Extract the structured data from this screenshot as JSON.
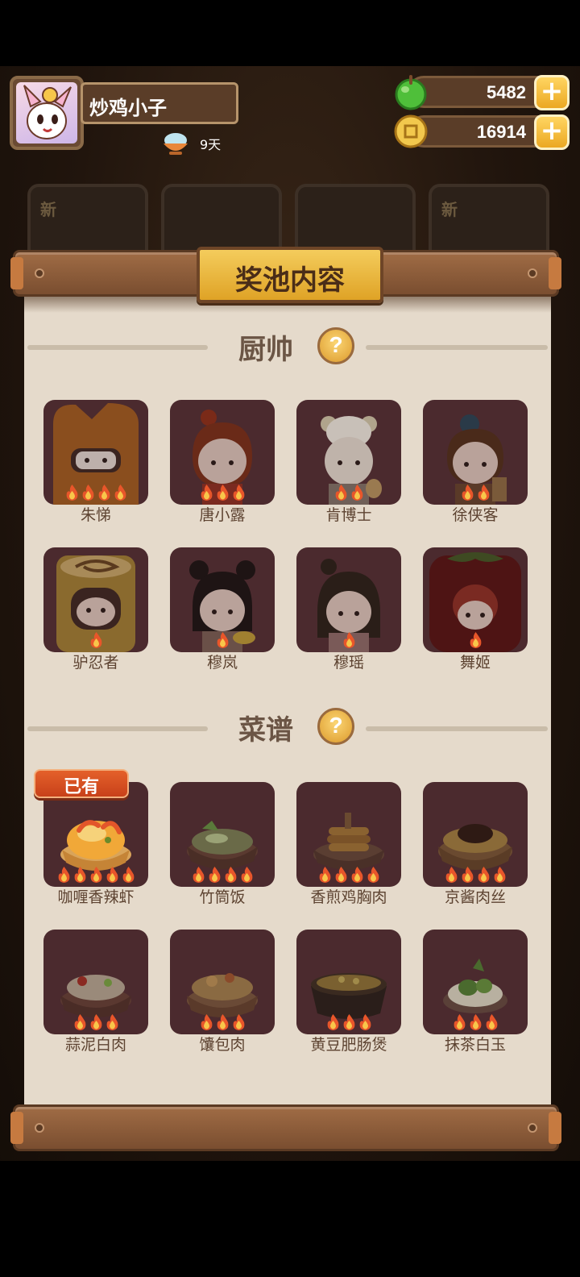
{
  "player": {
    "name": "炒鸡小子",
    "days": "9天"
  },
  "resources": {
    "green_value": "5482",
    "coin_value": "16914",
    "plus_label": "+"
  },
  "background": {
    "new_label": "新"
  },
  "popup": {
    "title": "奖池内容",
    "chef_section": {
      "title": "厨帅",
      "help_label": "?",
      "items": [
        {
          "label": "朱悌",
          "stars": 4
        },
        {
          "label": "唐小露",
          "stars": 3
        },
        {
          "label": "肯博士",
          "stars": 2
        },
        {
          "label": "徐侠客",
          "stars": 2
        },
        {
          "label": "驴忍者",
          "stars": 1
        },
        {
          "label": "穆岚",
          "stars": 1
        },
        {
          "label": "穆瑶",
          "stars": 1
        },
        {
          "label": "舞姬",
          "stars": 1
        }
      ]
    },
    "recipe_section": {
      "title": "菜谱",
      "help_label": "?",
      "owned_label": "已有",
      "items": [
        {
          "label": "咖喱香辣虾",
          "stars": 5
        },
        {
          "label": "竹筒饭",
          "stars": 4
        },
        {
          "label": "香煎鸡胸肉",
          "stars": 4
        },
        {
          "label": "京酱肉丝",
          "stars": 4
        },
        {
          "label": "蒜泥白肉",
          "stars": 3
        },
        {
          "label": "馕包肉",
          "stars": 3
        },
        {
          "label": "黄豆肥肠煲",
          "stars": 3
        },
        {
          "label": "抹茶白玉",
          "stars": 3
        }
      ]
    }
  },
  "colors": {
    "tile_bg": "#4b2a2e",
    "paper": "#e5dacb",
    "accent_gold": "#f4cc5c",
    "owned_tag": "#d9501f"
  }
}
